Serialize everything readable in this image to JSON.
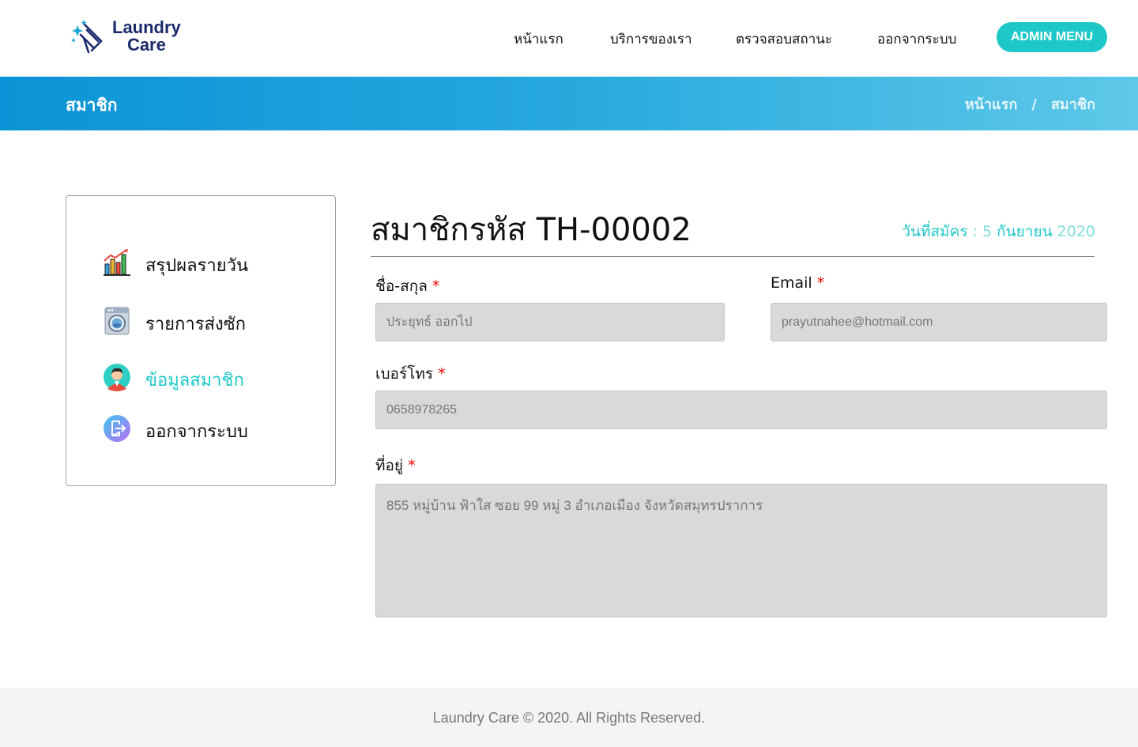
{
  "header": {
    "logo_line1": "Laundry",
    "logo_line2": "Care",
    "nav": {
      "home": "หน้าแรก",
      "services": "บริการของเรา",
      "status": "ตรวจสอบสถานะ",
      "logout": "ออกจากระบบ"
    },
    "admin_button": "ADMIN MENU"
  },
  "banner": {
    "title": "สมาชิก",
    "breadcrumb": [
      "หน้าแรก",
      "/",
      "สมาชิก"
    ]
  },
  "sidebar": {
    "items": [
      {
        "label": "สรุปผลรายวัน",
        "icon": "chart-icon"
      },
      {
        "label": "รายการส่งซัก",
        "icon": "washing-machine-icon"
      },
      {
        "label": "ข้อมูลสมาชิก",
        "icon": "user-avatar-icon",
        "active": true
      },
      {
        "label": "ออกจากระบบ",
        "icon": "logout-icon"
      }
    ]
  },
  "member": {
    "title": "สมาชิกรหัส TH-00002",
    "join_date_label": "วันที่สมัคร",
    "join_date_sep": " : ",
    "join_date_day": "5",
    "join_date_month": "กันยายน",
    "join_date_year": "2020"
  },
  "form": {
    "name_label": "ชื่อ-สกุล",
    "name_value": "ประยุทธ์ ออกไป",
    "email_label": "Email",
    "email_value": "prayutnahee@hotmail.com",
    "phone_label": "เบอร์โทร",
    "phone_value": "0658978265",
    "address_label": "ที่อยู่",
    "address_value": "855 หมู่บ้าน ฟ้าใส ซอย 99 หมู่ 3 อำเภอเมือง จังหวัดสมุทรปราการ",
    "required_mark": "*"
  },
  "footer": {
    "text": "Laundry Care © 2020. All Rights Reserved."
  },
  "colors": {
    "accent": "#1ec8c8",
    "banner_start": "#0a93d6",
    "banner_end": "#5ec8e8",
    "brand_navy": "#1b2a6b",
    "required": "#ee0000"
  }
}
